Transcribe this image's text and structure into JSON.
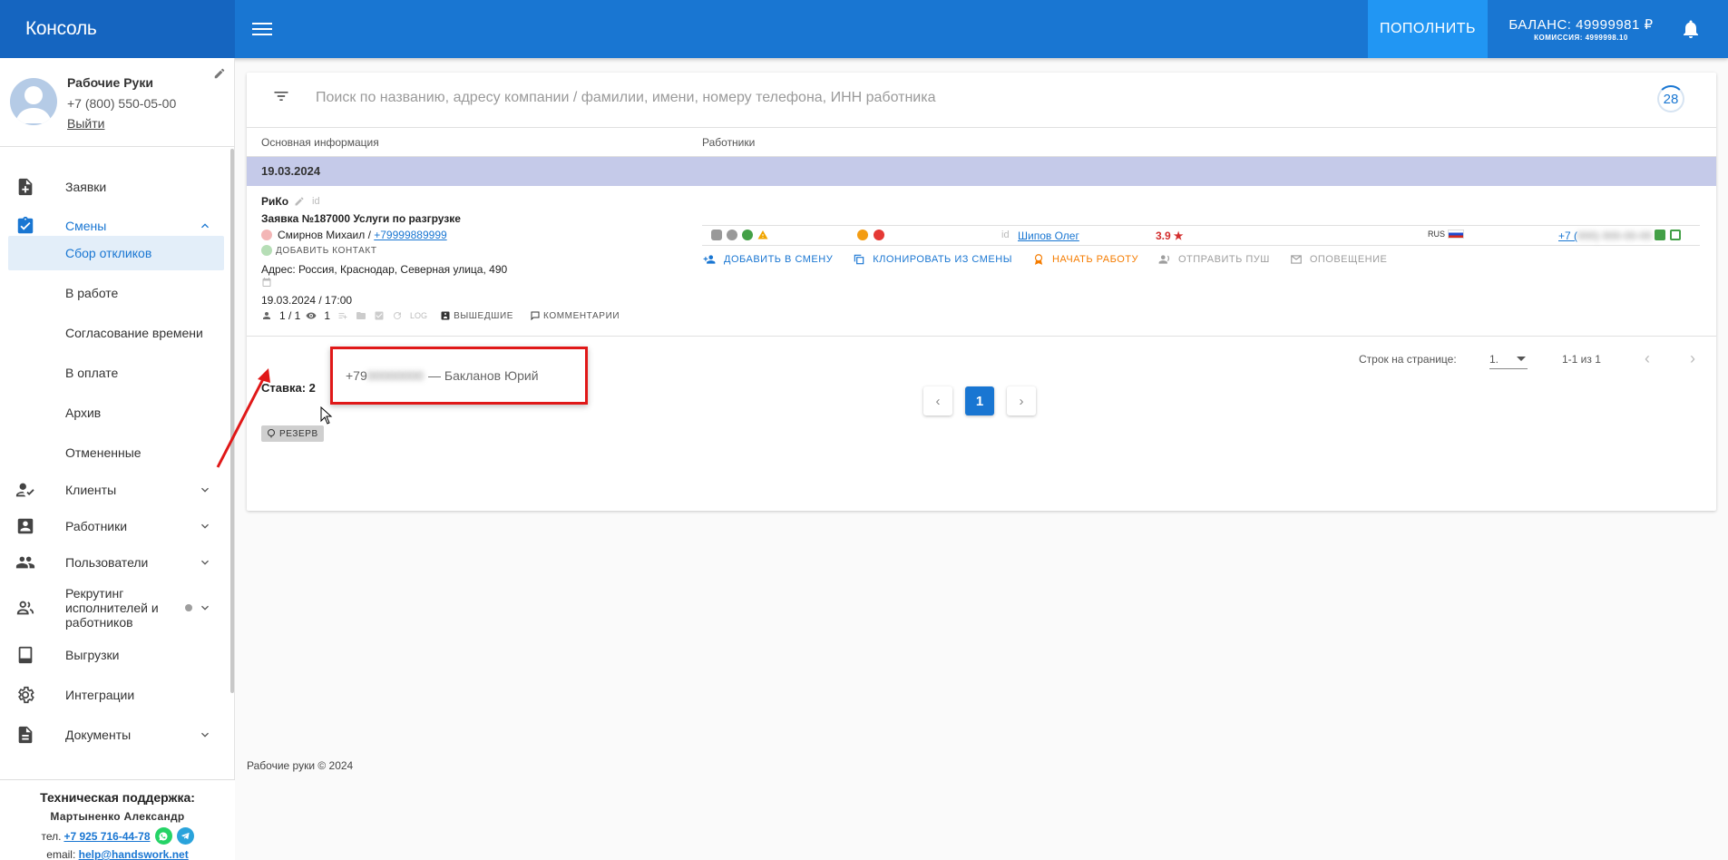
{
  "app": {
    "title": "Консоль"
  },
  "topbar": {
    "topup_label": "ПОПОЛНИТЬ",
    "balance": "БАЛАНС: 49999981 ₽",
    "commission": "КОМИССИЯ: 4999998.10",
    "accent": "#1976d2"
  },
  "profile": {
    "name": "Рабочие Руки",
    "phone": "+7 (800) 550-05-00",
    "logout": "Выйти"
  },
  "nav": {
    "orders": "Заявки",
    "shifts": "Смены",
    "shifts_sub": [
      "Сбор откликов",
      "В работе",
      "Согласование времени",
      "В оплате",
      "Архив",
      "Отмененные"
    ],
    "clients": "Клиенты",
    "workers": "Работники",
    "users": "Пользователи",
    "recruit": "Рекрутинг исполнителей и работников",
    "exports": "Выгрузки",
    "integrations": "Интеграции",
    "documents": "Документы"
  },
  "support": {
    "title": "Техническая поддержка:",
    "name": "Мартыненко Александр",
    "tel_label": "тел.",
    "tel": "+7 925 716-44-78",
    "email_label": "email:",
    "email": "help@handswork.net"
  },
  "search": {
    "placeholder": "Поиск по названию, адресу компании / фамилии, имени, номеру телефона, ИНН работника",
    "count": "28"
  },
  "table": {
    "col_main": "Основная информация",
    "col_workers": "Работники",
    "date_group": "19.03.2024"
  },
  "shift": {
    "company": "РиКо",
    "id_label": "id",
    "order": "Заявка №187000 Услуги по разгрузке",
    "contact_name": "Смирнов Михаил / ",
    "contact_phone": "+79999889999",
    "add_contact": "ДОБАВИТЬ КОНТАКТ",
    "address": "Адрес: Россия, Краснодар, Северная улица, 490",
    "datetime": "19.03.2024 / 17:00",
    "slots": "1 / 1",
    "views": "1",
    "log": "LOG",
    "went_out": "ВЫШЕДШИЕ",
    "comments": "КОММЕНТАРИИ",
    "reserve": "РЕЗЕРВ",
    "rate": "Ставка: 2"
  },
  "popup": {
    "phone_prefix": "+79",
    "phone_hidden": "00000000",
    "person": "— Бакланов Юрий"
  },
  "worker": {
    "id_label": "id",
    "name": "Шипов Олег",
    "rating": "3.9",
    "country": "RUS",
    "phone_prefix": "+7 (",
    "phone_hidden": "000) 000-00-00"
  },
  "actions": {
    "add": "ДОБАВИТЬ В СМЕНУ",
    "clone": "КЛОНИРОВАТЬ ИЗ СМЕНЫ",
    "start": "НАЧАТЬ РАБОТУ",
    "push": "ОТПРАВИТЬ ПУШ",
    "notify": "ОПОВЕЩЕНИЕ"
  },
  "pagination": {
    "rows_label": "Строк на странице:",
    "rows_value": "1.",
    "range": "1-1 из 1",
    "current": "1"
  },
  "footer": "Рабочие руки © 2024"
}
